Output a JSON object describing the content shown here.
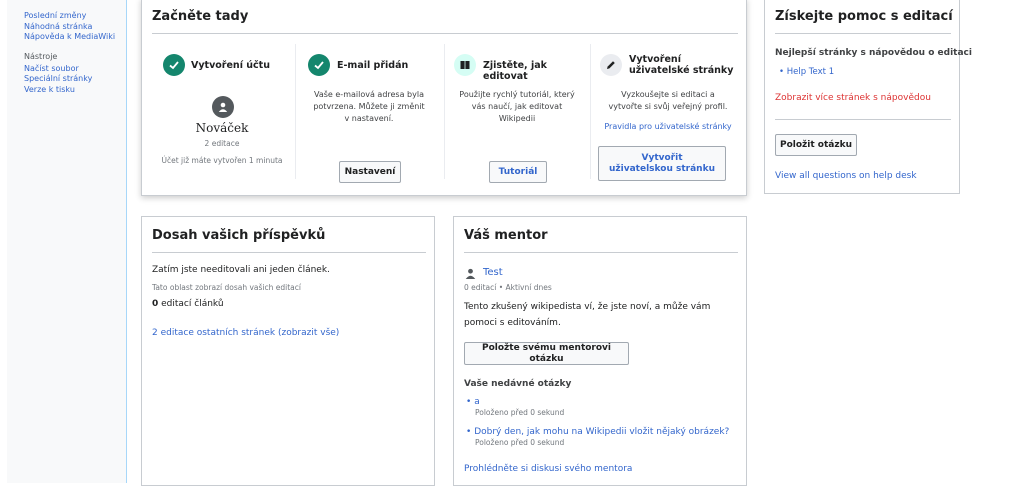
{
  "sidebar": {
    "links_top": [
      "Poslední změny",
      "Náhodná stránka",
      "Nápověda k MediaWiki"
    ],
    "tools_heading": "Nástroje",
    "tools": [
      "Načíst soubor",
      "Speciální stránky",
      "Verze k tisku"
    ]
  },
  "start": {
    "title": "Začněte tady",
    "account": {
      "title": "Vytvoření účtu",
      "username": "Nováček",
      "edits": "2 editace",
      "created": "Účet již máte vytvořen 1 minuta"
    },
    "email": {
      "title": "E-mail přidán",
      "text": "Vaše e-mailová adresa byla potvrzena. Můžete ji změnit v nastavení.",
      "button": "Nastavení"
    },
    "learn": {
      "title": "Zjistěte, jak editovat",
      "text": "Použijte rychlý tutoriál, který vás naučí, jak editovat Wikipedii",
      "button": "Tutoriál"
    },
    "userpage": {
      "title": "Vytvoření uživatelské stránky",
      "text": "Vyzkoušejte si editaci a vytvořte si svůj veřejný profil.",
      "link": "Pravidla pro uživatelské stránky",
      "button": "Vytvořit uživatelskou stránku"
    }
  },
  "help": {
    "title": "Získejte pomoc s editací",
    "subtitle": "Nejlepší stránky s nápovědou o editaci",
    "item": "Help Text 1",
    "more_link": "Zobrazit více stránek s nápovědou",
    "ask_button": "Položit otázku",
    "desk_link": "View all questions on help desk"
  },
  "impact": {
    "title": "Dosah vašich příspěvků",
    "none": "Zatím jste needitovali ani jeden článek.",
    "note": "Tato oblast zobrazí dosah vašich editací",
    "article_count": "0",
    "article_label": "editací článků",
    "other_link": "2 editace ostatních stránek (zobrazit vše)"
  },
  "mentor": {
    "title": "Váš mentor",
    "name": "Test",
    "meta": "0 editací • Aktivní dnes",
    "desc": "Tento zkušený wikipedista ví, že jste noví, a může vám pomoci s editováním.",
    "ask_button": "Položte svému mentorovi otázku",
    "recent_heading": "Vaše nedávné otázky",
    "questions": [
      {
        "text": "a",
        "time": "Položeno před 0 sekund"
      },
      {
        "text": "Dobrý den, jak mohu na Wikipedii vložit nějaký obrázek?",
        "time": "Položeno před 0 sekund"
      }
    ],
    "talk_link": "Prohlédněte si diskusi svého mentora"
  },
  "colors": {
    "accent": "#3366cc",
    "success": "#14866d",
    "learn_bg": "#d5fdf4",
    "border": "#c8ccd1",
    "link_red": "#d33"
  }
}
